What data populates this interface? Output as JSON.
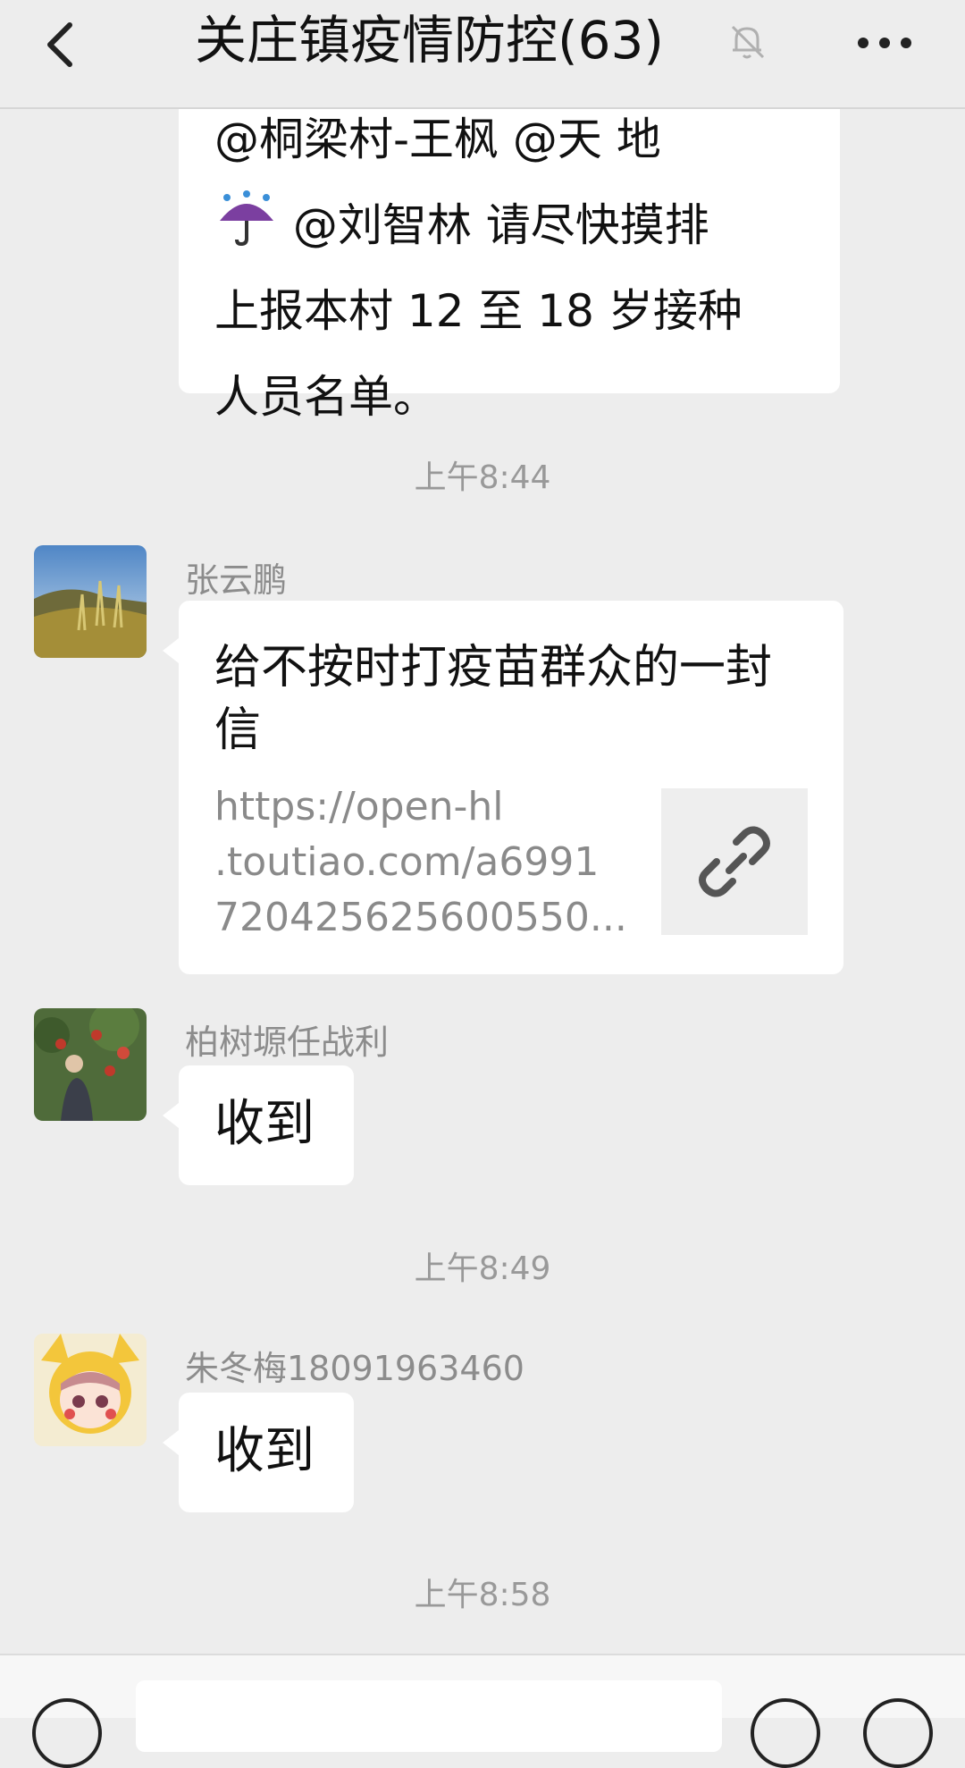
{
  "header": {
    "title": "关庄镇疫情防控(63)",
    "back_icon": "chevron-left-icon",
    "mute_icon": "bell-off-icon",
    "more_icon": "more-dots-icon"
  },
  "messages": {
    "first": {
      "line1": "@桐梁村-王枫 @天 地",
      "line2_after_emoji": " @刘智林  请尽快摸排",
      "line2_emoji": "umbrella-rain-icon",
      "line3": "上报本村 12 至 18 岁接种",
      "line4": "人员名单。"
    },
    "time1": "上午8:44",
    "msg2": {
      "sender": "张云鹏",
      "link_title": "给不按时打疫苗群众的一封信",
      "link_url_line1": "https://open-hl",
      "link_url_line2": ".toutiao.com/a6991",
      "link_url_line3": "720425625600550...",
      "link_icon": "link-icon"
    },
    "msg3": {
      "sender": "柏树塬任战利",
      "text": "收到"
    },
    "time2": "上午8:49",
    "msg4": {
      "sender": "朱冬梅18091963460",
      "text": "收到"
    },
    "time3": "上午8:58"
  },
  "input_bar": {
    "voice_icon": "voice-icon",
    "emoji_icon": "emoji-icon",
    "plus_icon": "plus-icon"
  },
  "colors": {
    "background": "#ededed",
    "bubble": "#ffffff",
    "meta_text": "#999999"
  }
}
